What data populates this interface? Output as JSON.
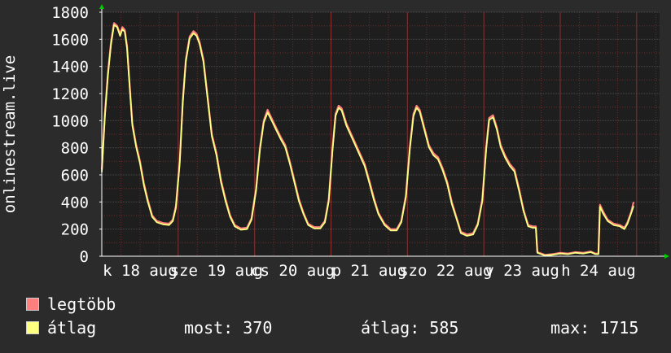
{
  "chart_data": {
    "type": "line",
    "ylabel": "onlinestream.live",
    "ylim": [
      0,
      1800
    ],
    "yticks": [
      "0",
      "200",
      "400",
      "600",
      "800",
      "1000",
      "1200",
      "1400",
      "1600",
      "1800"
    ],
    "xtick_labels": [
      "k 18 aug",
      "sze 19 aug",
      "cs 20 aug",
      "p 21 aug",
      "szo 22 aug",
      "v 23 aug",
      "h 24 aug"
    ],
    "x_day_span": [
      0,
      7.3
    ],
    "grid": true,
    "series": [
      {
        "name": "legtöbb",
        "color": "#ff7f7f",
        "points": [
          [
            0.0,
            640
          ],
          [
            0.04,
            1050
          ],
          [
            0.08,
            1350
          ],
          [
            0.12,
            1580
          ],
          [
            0.16,
            1720
          ],
          [
            0.2,
            1700
          ],
          [
            0.24,
            1640
          ],
          [
            0.27,
            1690
          ],
          [
            0.3,
            1670
          ],
          [
            0.33,
            1550
          ],
          [
            0.36,
            1300
          ],
          [
            0.4,
            980
          ],
          [
            0.45,
            820
          ],
          [
            0.5,
            700
          ],
          [
            0.55,
            540
          ],
          [
            0.6,
            420
          ],
          [
            0.66,
            300
          ],
          [
            0.72,
            260
          ],
          [
            0.8,
            245
          ],
          [
            0.88,
            240
          ],
          [
            0.93,
            270
          ],
          [
            0.97,
            370
          ],
          [
            1.02,
            700
          ],
          [
            1.06,
            1150
          ],
          [
            1.1,
            1450
          ],
          [
            1.15,
            1620
          ],
          [
            1.2,
            1660
          ],
          [
            1.24,
            1640
          ],
          [
            1.28,
            1580
          ],
          [
            1.33,
            1450
          ],
          [
            1.38,
            1200
          ],
          [
            1.44,
            900
          ],
          [
            1.5,
            760
          ],
          [
            1.56,
            560
          ],
          [
            1.62,
            420
          ],
          [
            1.68,
            300
          ],
          [
            1.74,
            230
          ],
          [
            1.82,
            205
          ],
          [
            1.9,
            210
          ],
          [
            1.96,
            280
          ],
          [
            2.02,
            500
          ],
          [
            2.07,
            800
          ],
          [
            2.12,
            1000
          ],
          [
            2.17,
            1080
          ],
          [
            2.22,
            1020
          ],
          [
            2.28,
            950
          ],
          [
            2.34,
            880
          ],
          [
            2.4,
            820
          ],
          [
            2.46,
            700
          ],
          [
            2.52,
            560
          ],
          [
            2.58,
            420
          ],
          [
            2.64,
            320
          ],
          [
            2.7,
            240
          ],
          [
            2.78,
            215
          ],
          [
            2.86,
            215
          ],
          [
            2.92,
            260
          ],
          [
            2.97,
            420
          ],
          [
            3.02,
            800
          ],
          [
            3.06,
            1050
          ],
          [
            3.1,
            1110
          ],
          [
            3.14,
            1090
          ],
          [
            3.2,
            980
          ],
          [
            3.28,
            880
          ],
          [
            3.36,
            780
          ],
          [
            3.44,
            680
          ],
          [
            3.5,
            560
          ],
          [
            3.56,
            430
          ],
          [
            3.62,
            320
          ],
          [
            3.7,
            240
          ],
          [
            3.78,
            200
          ],
          [
            3.86,
            200
          ],
          [
            3.92,
            260
          ],
          [
            3.98,
            450
          ],
          [
            4.03,
            800
          ],
          [
            4.08,
            1050
          ],
          [
            4.12,
            1110
          ],
          [
            4.16,
            1080
          ],
          [
            4.22,
            950
          ],
          [
            4.28,
            820
          ],
          [
            4.34,
            760
          ],
          [
            4.4,
            730
          ],
          [
            4.46,
            650
          ],
          [
            4.52,
            550
          ],
          [
            4.58,
            400
          ],
          [
            4.64,
            290
          ],
          [
            4.7,
            180
          ],
          [
            4.78,
            160
          ],
          [
            4.86,
            170
          ],
          [
            4.92,
            240
          ],
          [
            4.98,
            420
          ],
          [
            5.03,
            800
          ],
          [
            5.07,
            1020
          ],
          [
            5.12,
            1040
          ],
          [
            5.17,
            950
          ],
          [
            5.22,
            820
          ],
          [
            5.28,
            740
          ],
          [
            5.34,
            680
          ],
          [
            5.4,
            640
          ],
          [
            5.46,
            500
          ],
          [
            5.52,
            340
          ],
          [
            5.58,
            230
          ],
          [
            5.64,
            220
          ],
          [
            5.68,
            220
          ],
          [
            5.7,
            30
          ],
          [
            5.8,
            10
          ],
          [
            5.9,
            15
          ],
          [
            6.0,
            25
          ],
          [
            6.1,
            20
          ],
          [
            6.2,
            30
          ],
          [
            6.3,
            25
          ],
          [
            6.4,
            35
          ],
          [
            6.46,
            20
          ],
          [
            6.5,
            20
          ],
          [
            6.52,
            380
          ],
          [
            6.56,
            330
          ],
          [
            6.62,
            270
          ],
          [
            6.7,
            240
          ],
          [
            6.78,
            230
          ],
          [
            6.84,
            210
          ],
          [
            6.88,
            250
          ],
          [
            6.93,
            330
          ],
          [
            6.96,
            400
          ]
        ]
      },
      {
        "name": "átlag",
        "color": "#ffff80",
        "points": [
          [
            0.0,
            620
          ],
          [
            0.04,
            1030
          ],
          [
            0.08,
            1330
          ],
          [
            0.12,
            1560
          ],
          [
            0.16,
            1705
          ],
          [
            0.2,
            1690
          ],
          [
            0.24,
            1625
          ],
          [
            0.27,
            1675
          ],
          [
            0.3,
            1655
          ],
          [
            0.33,
            1535
          ],
          [
            0.36,
            1285
          ],
          [
            0.4,
            965
          ],
          [
            0.45,
            805
          ],
          [
            0.5,
            685
          ],
          [
            0.55,
            525
          ],
          [
            0.6,
            405
          ],
          [
            0.66,
            290
          ],
          [
            0.72,
            250
          ],
          [
            0.8,
            235
          ],
          [
            0.88,
            230
          ],
          [
            0.93,
            260
          ],
          [
            0.97,
            355
          ],
          [
            1.02,
            685
          ],
          [
            1.06,
            1135
          ],
          [
            1.1,
            1435
          ],
          [
            1.15,
            1605
          ],
          [
            1.2,
            1645
          ],
          [
            1.24,
            1625
          ],
          [
            1.28,
            1565
          ],
          [
            1.33,
            1435
          ],
          [
            1.38,
            1185
          ],
          [
            1.44,
            885
          ],
          [
            1.5,
            745
          ],
          [
            1.56,
            545
          ],
          [
            1.62,
            405
          ],
          [
            1.68,
            290
          ],
          [
            1.74,
            220
          ],
          [
            1.82,
            195
          ],
          [
            1.9,
            200
          ],
          [
            1.96,
            270
          ],
          [
            2.02,
            485
          ],
          [
            2.07,
            785
          ],
          [
            2.12,
            985
          ],
          [
            2.17,
            1060
          ],
          [
            2.22,
            1005
          ],
          [
            2.28,
            935
          ],
          [
            2.34,
            865
          ],
          [
            2.4,
            805
          ],
          [
            2.46,
            685
          ],
          [
            2.52,
            545
          ],
          [
            2.58,
            405
          ],
          [
            2.64,
            310
          ],
          [
            2.7,
            230
          ],
          [
            2.78,
            205
          ],
          [
            2.86,
            205
          ],
          [
            2.92,
            250
          ],
          [
            2.97,
            405
          ],
          [
            3.02,
            785
          ],
          [
            3.06,
            1035
          ],
          [
            3.1,
            1095
          ],
          [
            3.14,
            1075
          ],
          [
            3.2,
            965
          ],
          [
            3.28,
            865
          ],
          [
            3.36,
            765
          ],
          [
            3.44,
            665
          ],
          [
            3.5,
            545
          ],
          [
            3.56,
            415
          ],
          [
            3.62,
            310
          ],
          [
            3.7,
            230
          ],
          [
            3.78,
            190
          ],
          [
            3.86,
            190
          ],
          [
            3.92,
            250
          ],
          [
            3.98,
            435
          ],
          [
            4.03,
            785
          ],
          [
            4.08,
            1035
          ],
          [
            4.12,
            1095
          ],
          [
            4.16,
            1065
          ],
          [
            4.22,
            935
          ],
          [
            4.28,
            805
          ],
          [
            4.34,
            745
          ],
          [
            4.4,
            715
          ],
          [
            4.46,
            635
          ],
          [
            4.52,
            535
          ],
          [
            4.58,
            385
          ],
          [
            4.64,
            280
          ],
          [
            4.7,
            170
          ],
          [
            4.78,
            150
          ],
          [
            4.86,
            160
          ],
          [
            4.92,
            230
          ],
          [
            4.98,
            405
          ],
          [
            5.03,
            785
          ],
          [
            5.07,
            1005
          ],
          [
            5.12,
            1025
          ],
          [
            5.17,
            935
          ],
          [
            5.22,
            805
          ],
          [
            5.28,
            725
          ],
          [
            5.34,
            665
          ],
          [
            5.4,
            625
          ],
          [
            5.46,
            485
          ],
          [
            5.52,
            330
          ],
          [
            5.58,
            220
          ],
          [
            5.64,
            210
          ],
          [
            5.68,
            210
          ],
          [
            5.7,
            25
          ],
          [
            5.8,
            5
          ],
          [
            5.9,
            10
          ],
          [
            6.0,
            20
          ],
          [
            6.1,
            15
          ],
          [
            6.2,
            25
          ],
          [
            6.3,
            20
          ],
          [
            6.4,
            30
          ],
          [
            6.46,
            15
          ],
          [
            6.5,
            15
          ],
          [
            6.52,
            365
          ],
          [
            6.56,
            315
          ],
          [
            6.62,
            260
          ],
          [
            6.7,
            230
          ],
          [
            6.78,
            220
          ],
          [
            6.84,
            200
          ],
          [
            6.88,
            240
          ],
          [
            6.93,
            320
          ],
          [
            6.96,
            370
          ]
        ]
      }
    ]
  },
  "legend": {
    "items": [
      {
        "label": "legtöbb",
        "color": "#ff7f7f"
      },
      {
        "label": "átlag",
        "color": "#ffff80"
      }
    ]
  },
  "stats": {
    "current": "most: 370",
    "average": "átlag: 585",
    "max": "max: 1715"
  },
  "colors": {
    "plot_bg": "#1e1e1e",
    "grid": "#6b2a2a",
    "axis": "#ffffff",
    "arrow": "#00cc00"
  }
}
